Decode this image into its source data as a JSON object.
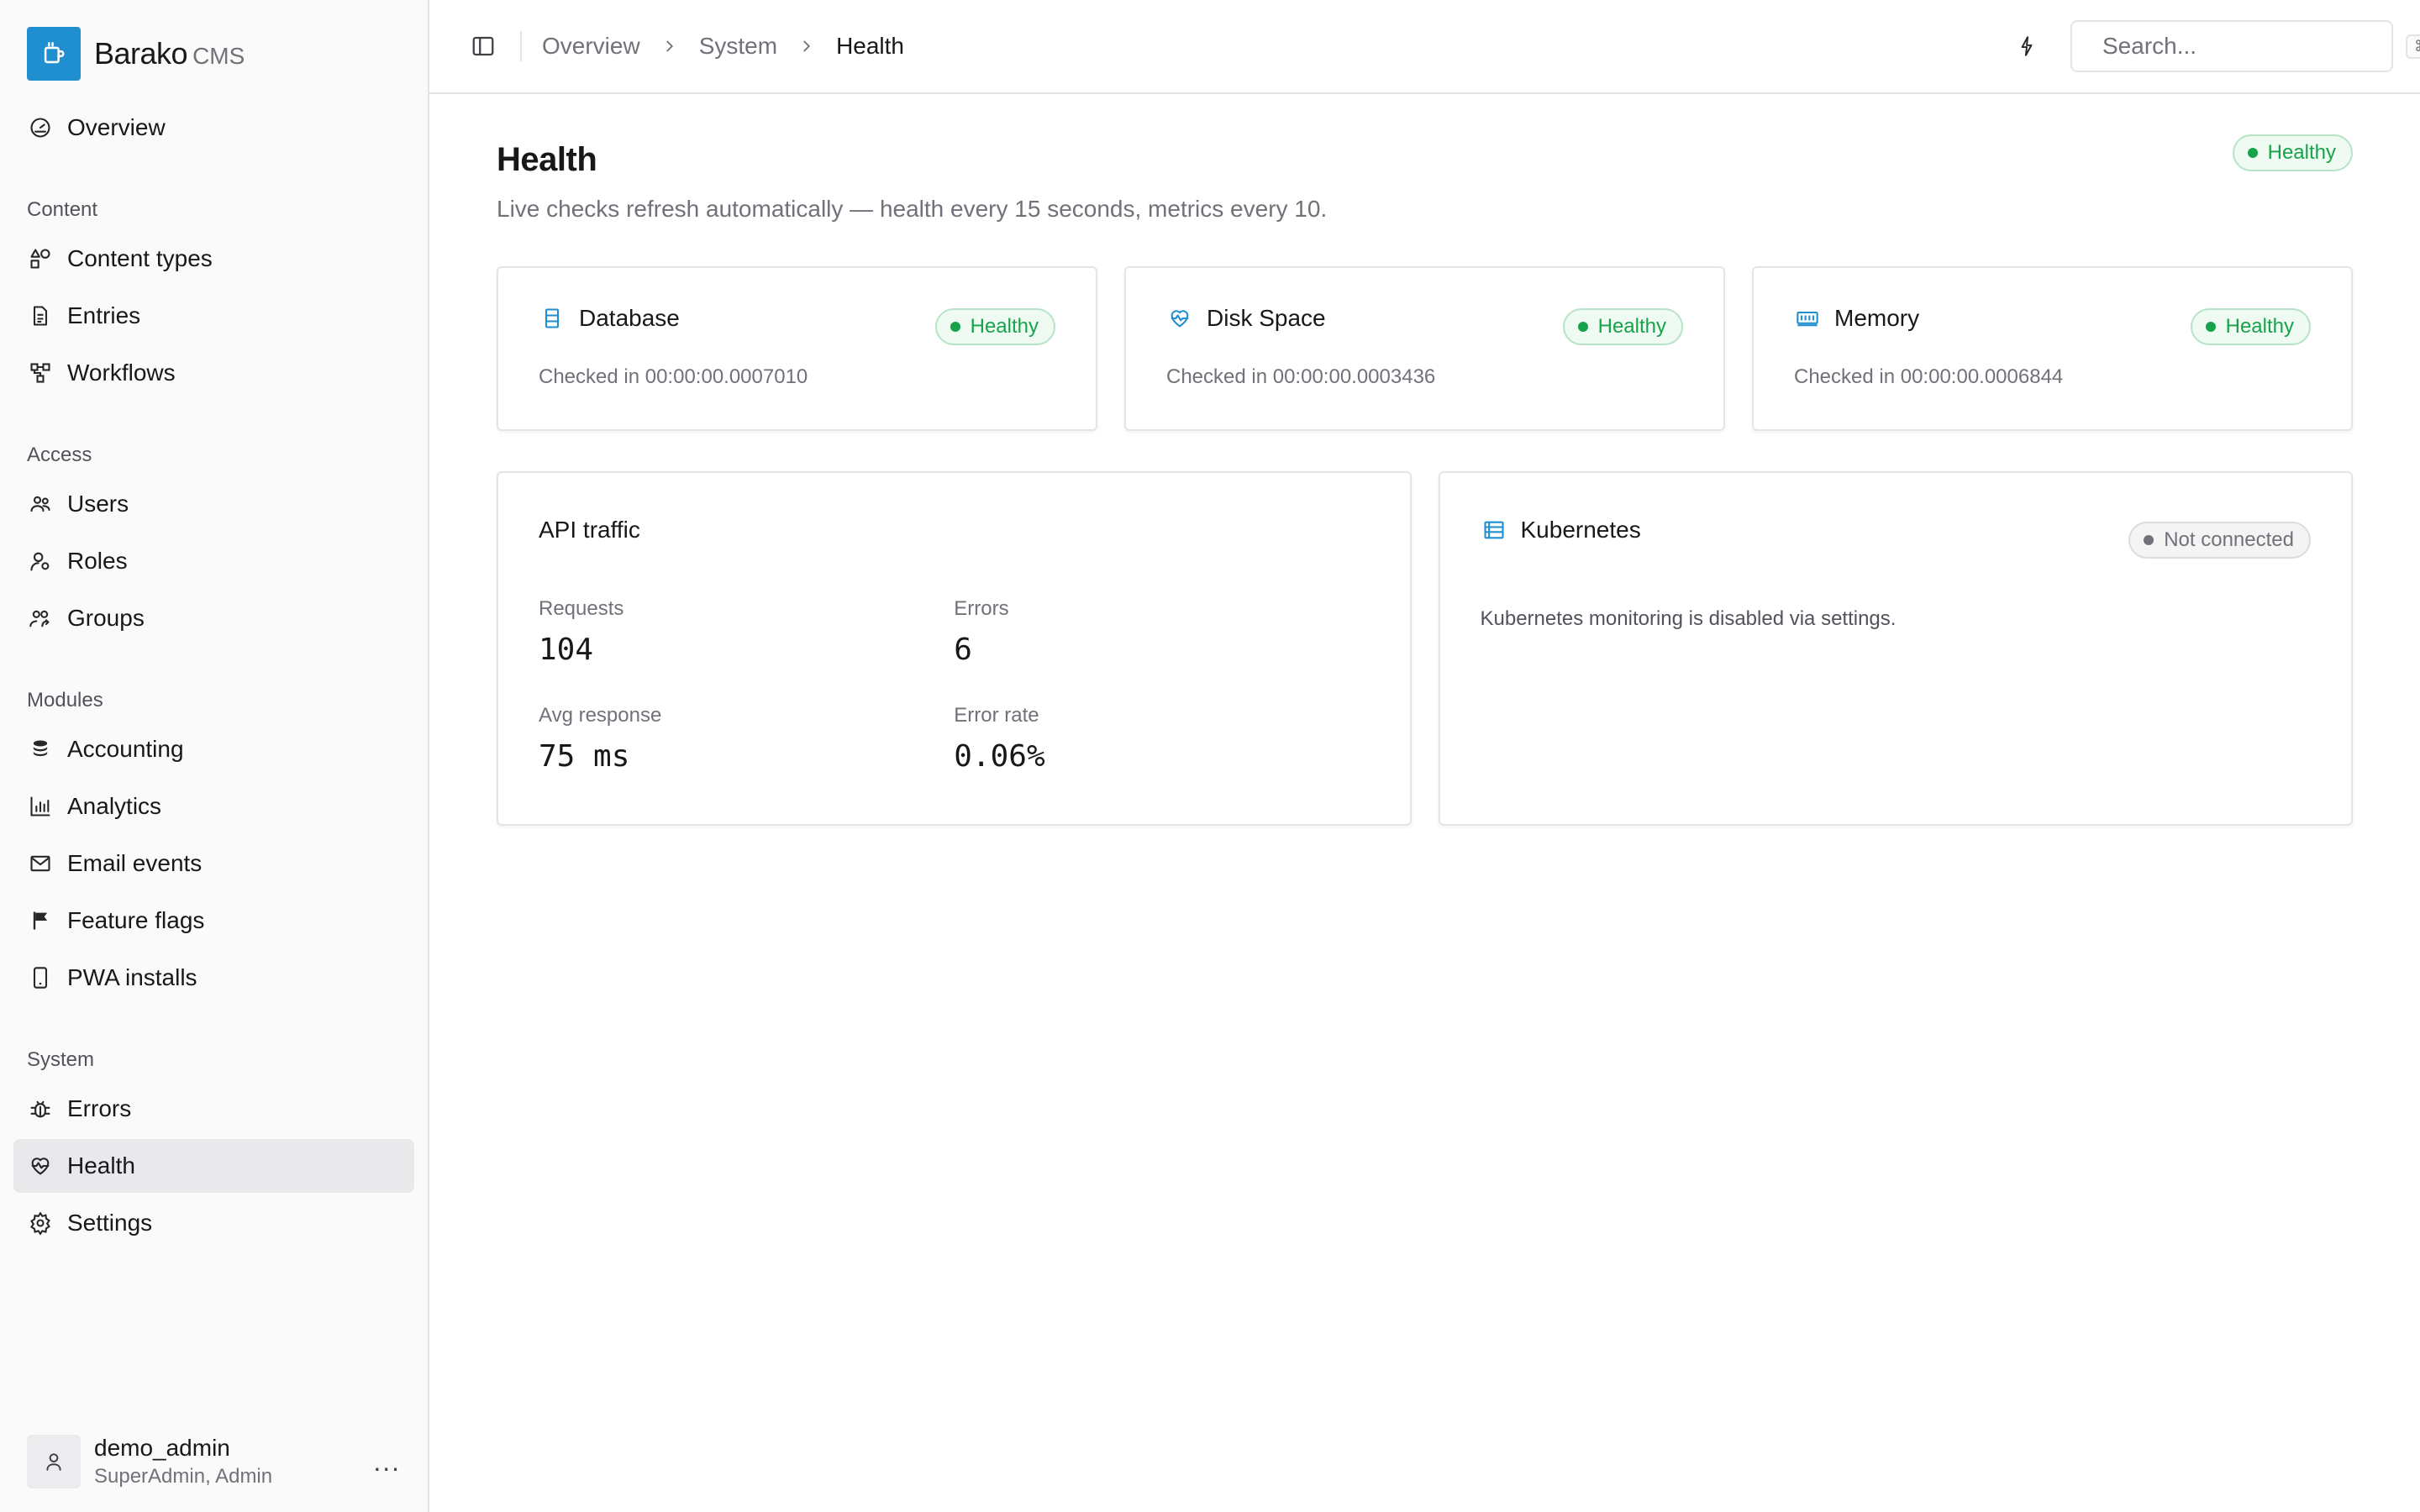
{
  "brand": {
    "name": "Barako",
    "sub": "CMS"
  },
  "nav": {
    "top": [
      {
        "label": "Overview",
        "icon": "gauge-icon"
      }
    ],
    "sections": [
      {
        "label": "Content",
        "items": [
          {
            "label": "Content types",
            "icon": "shapes-icon"
          },
          {
            "label": "Entries",
            "icon": "document-icon"
          },
          {
            "label": "Workflows",
            "icon": "workflow-icon"
          }
        ]
      },
      {
        "label": "Access",
        "items": [
          {
            "label": "Users",
            "icon": "users-icon"
          },
          {
            "label": "Roles",
            "icon": "roles-icon"
          },
          {
            "label": "Groups",
            "icon": "groups-icon"
          }
        ]
      },
      {
        "label": "Modules",
        "items": [
          {
            "label": "Accounting",
            "icon": "coins-icon"
          },
          {
            "label": "Analytics",
            "icon": "bar-chart-icon"
          },
          {
            "label": "Email events",
            "icon": "mail-icon"
          },
          {
            "label": "Feature flags",
            "icon": "flag-icon"
          },
          {
            "label": "PWA installs",
            "icon": "smartphone-icon"
          }
        ]
      },
      {
        "label": "System",
        "items": [
          {
            "label": "Errors",
            "icon": "bug-icon"
          },
          {
            "label": "Health",
            "icon": "heart-pulse-icon",
            "active": true
          },
          {
            "label": "Settings",
            "icon": "gear-icon"
          }
        ]
      }
    ]
  },
  "user": {
    "name": "demo_admin",
    "roles": "SuperAdmin, Admin",
    "more": "..."
  },
  "breadcrumb": {
    "items": [
      "Overview",
      "System",
      "Health"
    ]
  },
  "search": {
    "placeholder": "Search...",
    "shortcut": "⌘K"
  },
  "page": {
    "title": "Health",
    "subtitle": "Live checks refresh automatically — health every 15 seconds, metrics every 10.",
    "status": "Healthy"
  },
  "checks": [
    {
      "title": "Database",
      "status": "Healthy",
      "checked": "Checked in 00:00:00.0007010"
    },
    {
      "title": "Disk Space",
      "status": "Healthy",
      "checked": "Checked in 00:00:00.0003436"
    },
    {
      "title": "Memory",
      "status": "Healthy",
      "checked": "Checked in 00:00:00.0006844"
    }
  ],
  "api_traffic": {
    "title": "API traffic",
    "requests_label": "Requests",
    "requests": "104",
    "errors_label": "Errors",
    "errors": "6",
    "avg_label": "Avg response",
    "avg": "75 ms",
    "rate_label": "Error rate",
    "rate": "0.06%"
  },
  "kubernetes": {
    "title": "Kubernetes",
    "status": "Not connected",
    "message": "Kubernetes monitoring is disabled via settings."
  },
  "colors": {
    "accent": "#1f8fcf",
    "healthy": "#16a34a",
    "muted": "#71717a",
    "active_bg": "#e9e9eb"
  }
}
